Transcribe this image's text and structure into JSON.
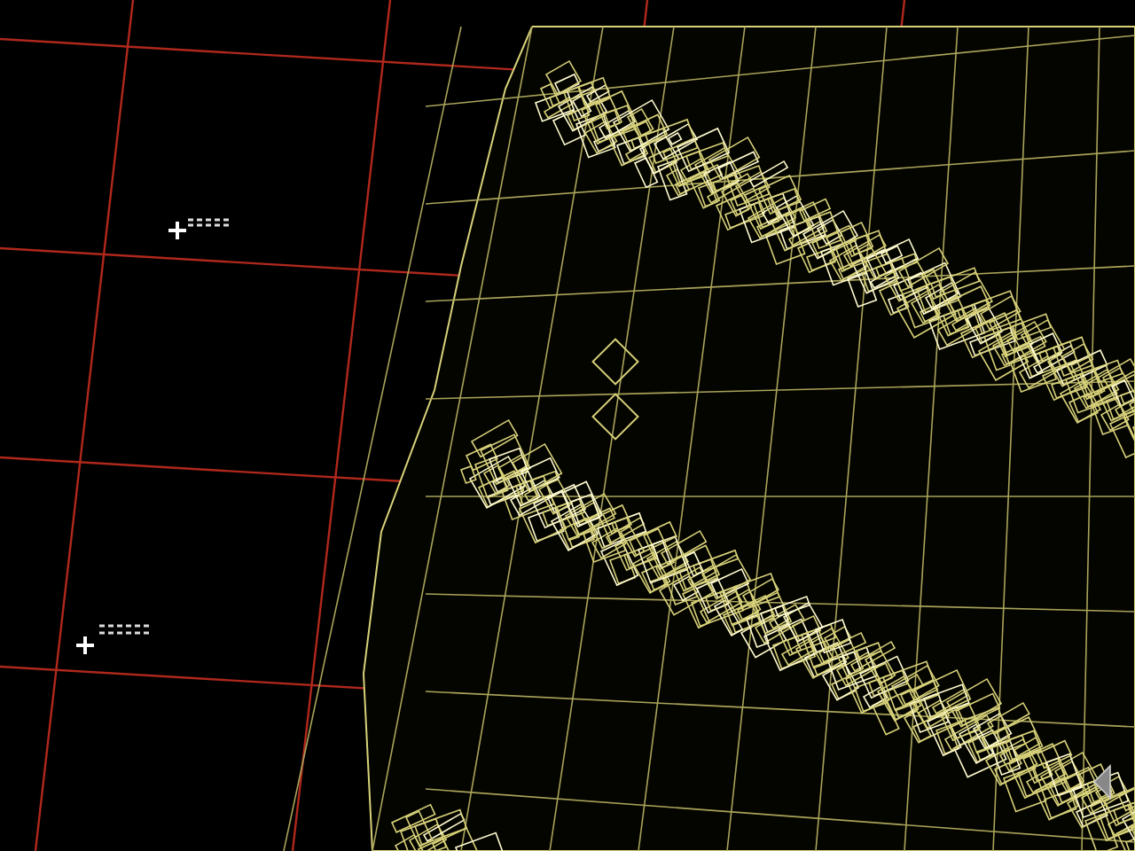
{
  "viewport": {
    "kind": "wireframe_map"
  }
}
